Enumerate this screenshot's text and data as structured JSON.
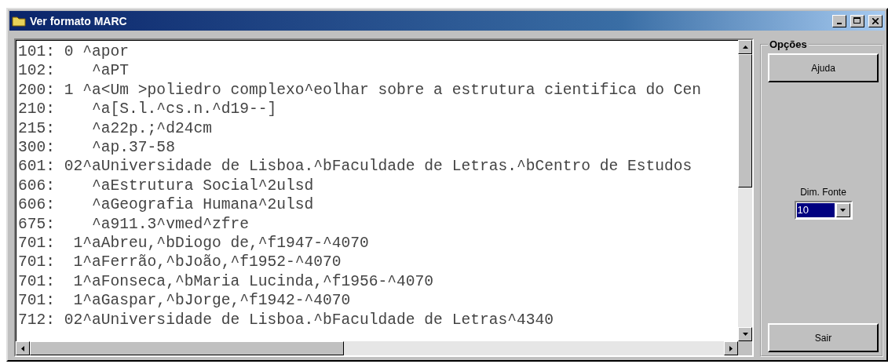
{
  "window": {
    "title": "Ver formato MARC"
  },
  "record_lines": [
    "101: 0 ^apor",
    "102:    ^aPT",
    "200: 1 ^a<Um >poliedro complexo^eolhar sobre a estrutura cientifica do Cen",
    "210:    ^a[S.l.^cs.n.^d19--]",
    "215:    ^a22p.;^d24cm",
    "300:    ^ap.37-58",
    "601: 02^aUniversidade de Lisboa.^bFaculdade de Letras.^bCentro de Estudos",
    "606:    ^aEstrutura Social^2ulsd",
    "606:    ^aGeografia Humana^2ulsd",
    "675:    ^a911.3^vmed^zfre",
    "701:  1^aAbreu,^bDiogo de,^f1947-^4070",
    "701:  1^aFerrão,^bJoão,^f1952-^4070",
    "701:  1^aFonseca,^bMaria Lucinda,^f1956-^4070",
    "701:  1^aGaspar,^bJorge,^f1942-^4070",
    "712: 02^aUniversidade de Lisboa.^bFaculdade de Letras^4340"
  ],
  "options": {
    "title": "Opções",
    "help_button": "Ajuda",
    "font_size_label": "Dim. Fonte",
    "font_size_value": "10",
    "exit_button": "Sair"
  }
}
